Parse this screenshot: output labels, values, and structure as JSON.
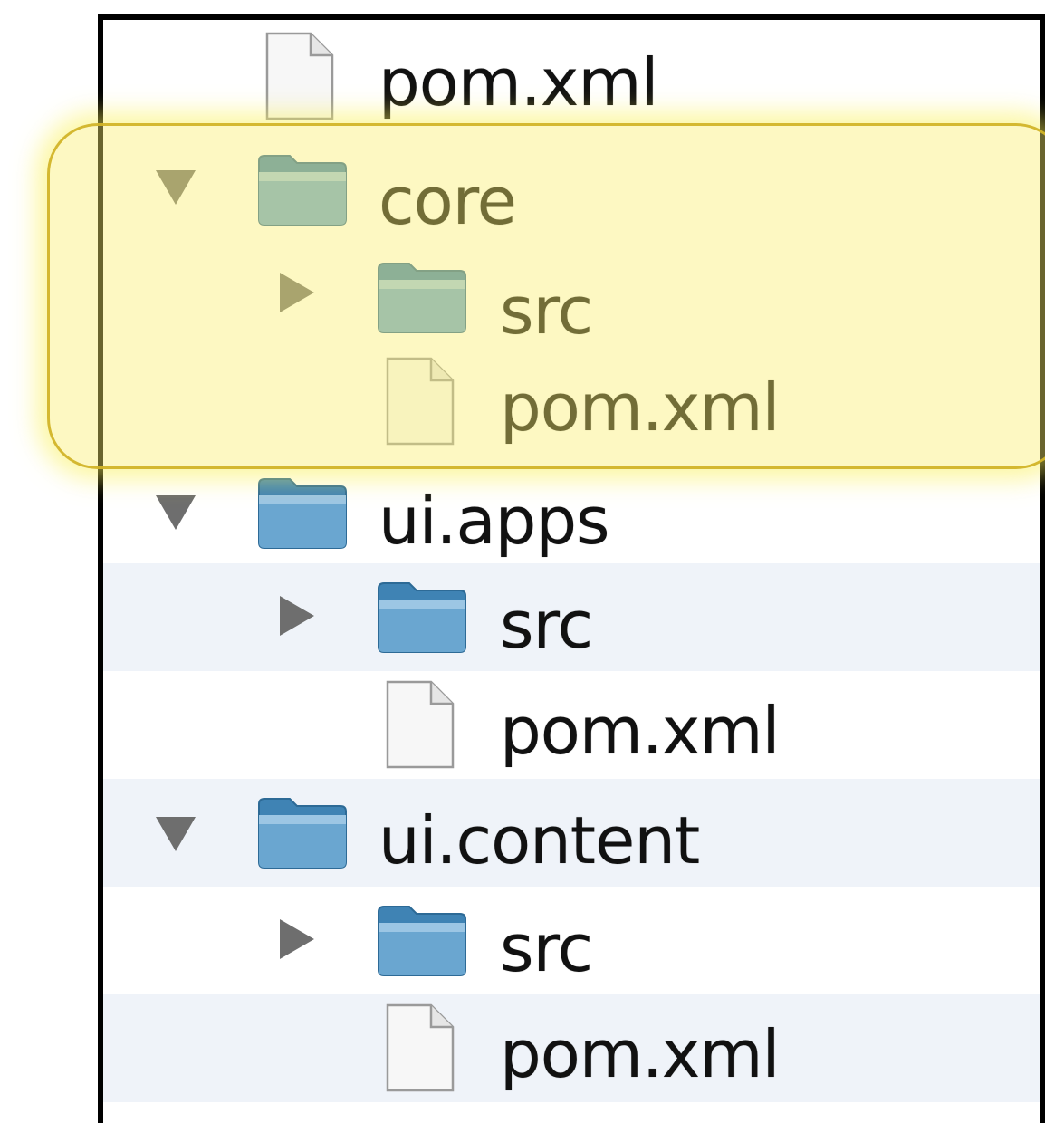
{
  "tree": {
    "items": [
      {
        "label": "pom.xml",
        "type": "file",
        "icon": "file-icon"
      },
      {
        "label": "core",
        "type": "folder",
        "expanded": true,
        "icon": "folder-icon"
      },
      {
        "label": "src",
        "type": "folder",
        "expanded": false,
        "icon": "folder-icon"
      },
      {
        "label": "pom.xml",
        "type": "file",
        "icon": "file-icon"
      },
      {
        "label": "ui.apps",
        "type": "folder",
        "expanded": true,
        "icon": "folder-icon"
      },
      {
        "label": "src",
        "type": "folder",
        "expanded": false,
        "icon": "folder-icon"
      },
      {
        "label": "pom.xml",
        "type": "file",
        "icon": "file-icon"
      },
      {
        "label": "ui.content",
        "type": "folder",
        "expanded": true,
        "icon": "folder-icon"
      },
      {
        "label": "src",
        "type": "folder",
        "expanded": false,
        "icon": "folder-icon"
      },
      {
        "label": "pom.xml",
        "type": "file",
        "icon": "file-icon"
      }
    ]
  },
  "highlight": {
    "label": "core module highlight",
    "color": "#f5e96e"
  },
  "colors": {
    "folder_blue": "#4f8fba",
    "triangle_gray": "#6e6e6e",
    "row_alt": "#eff3f9"
  }
}
